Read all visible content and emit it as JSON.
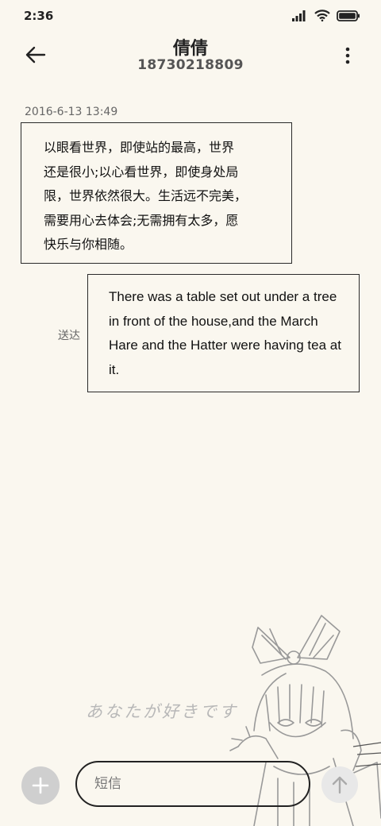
{
  "status_bar": {
    "time": "2:36",
    "icons": [
      "signal-icon",
      "wifi-icon",
      "battery-icon"
    ]
  },
  "header": {
    "contact_name": "倩倩",
    "phone_number": "18730218809",
    "back_icon": "arrow-left-icon",
    "more_icon": "more-vertical-icon"
  },
  "conversation": {
    "timestamp": "2016-6-13 13:49",
    "received_message": "以眼看世界，即使站的最高，世界\n还是很小;以心看世界，即使身处局\n限，世界依然很大。生活远不完美，\n需要用心去体会;无需拥有太多，愿\n快乐与你相随。",
    "sent_message": "There was a table set out under a tree in front of the house,and the March Hare and the Hatter were having tea at it.",
    "sent_status": "送达"
  },
  "wallpaper": {
    "handwriting": "あなたが好きです"
  },
  "composer": {
    "placeholder": "短信",
    "add_icon": "plus-icon",
    "send_icon": "arrow-up-icon"
  },
  "colors": {
    "background": "#faf7ef",
    "border": "#2a2a2a",
    "add_button": "#cfcfcf",
    "send_button": "#e8e8e8"
  }
}
